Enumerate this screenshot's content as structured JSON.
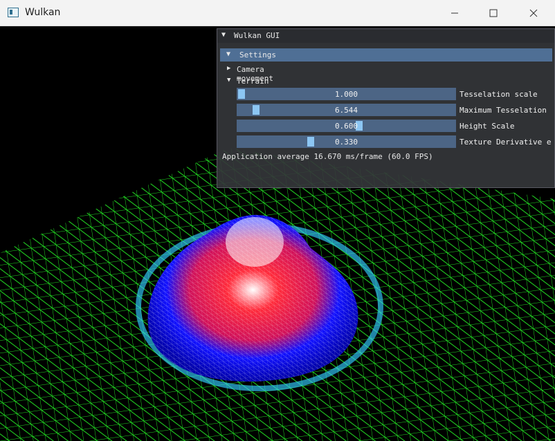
{
  "window": {
    "title": "Wulkan"
  },
  "controls": {
    "minimize": "minimize",
    "maximize": "maximize",
    "close": "close"
  },
  "gui": {
    "title": "Wulkan GUI",
    "settings_label": "Settings",
    "camera_label": "Camera movement",
    "terrain_label": "Terrain",
    "sliders": [
      {
        "label": "Tesselation scale",
        "value": "1.000",
        "level": 0.0
      },
      {
        "label": "Maximum Tesselation",
        "value": "6.544",
        "level": 0.07
      },
      {
        "label": "Height Scale",
        "value": "0.600",
        "level": 0.56
      },
      {
        "label": "Texture Derivative e",
        "value": "0.330",
        "level": 0.33
      }
    ],
    "status": "Application average 16.670 ms/frame (60.0 FPS)"
  },
  "colors": {
    "grid": "#22dd22",
    "hill_low": "#0000ff",
    "hill_mid": "#ff0033",
    "hill_top": "#ffffff",
    "hill_outline": "#33ccff",
    "gui_bg": "#34363a",
    "slider_bg": "#4c6585",
    "slider_grab": "#8cc6f3",
    "header_bg": "#4f6f95"
  }
}
